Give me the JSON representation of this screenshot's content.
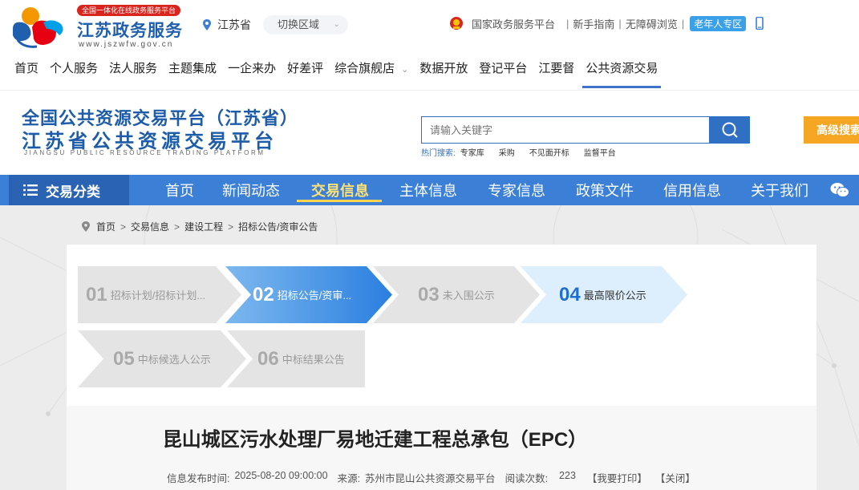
{
  "site": {
    "badge": "全国一体化在线政务服务平台",
    "name": "江苏政务服务",
    "url": "www.jszwfw.gov.cn"
  },
  "region": {
    "current": "江苏省",
    "switch_label": "切换区域"
  },
  "toplinks": {
    "national": "国家政务服务平台",
    "guide": "新手指南",
    "accessible": "无障碍浏览",
    "elder": "老年人专区"
  },
  "mainnav": [
    "首页",
    "个人服务",
    "法人服务",
    "主题集成",
    "一企来办",
    "好差评",
    "综合旗舰店",
    "数据开放",
    "登记平台",
    "江要督",
    "公共资源交易"
  ],
  "platform": {
    "title1": "全国公共资源交易平台（江苏省）",
    "title2": "江苏省公共资源交易平台",
    "title_en": "JIANGSU PUBLIC RESOURCE TRADING PLATFORM"
  },
  "search": {
    "placeholder": "请输入关键字",
    "hot_label": "热门搜索:",
    "hot_keywords": [
      "专家库",
      "采购",
      "不见面开标",
      "监督平台"
    ],
    "advanced_label": "高级搜索"
  },
  "bluenav": {
    "category_label": "交易分类",
    "items": [
      "首页",
      "新闻动态",
      "交易信息",
      "主体信息",
      "专家信息",
      "政策文件",
      "信用信息",
      "关于我们"
    ]
  },
  "breadcrumb": [
    "首页",
    "交易信息",
    "建设工程",
    "招标公告/资审公告"
  ],
  "steps": [
    {
      "num": "01",
      "label": "招标计划/招标计划...",
      "state": "inactive"
    },
    {
      "num": "02",
      "label": "招标公告/资审...",
      "state": "current"
    },
    {
      "num": "03",
      "label": "未入围公示",
      "state": "inactive"
    },
    {
      "num": "04",
      "label": "最高限价公示",
      "state": "available"
    },
    {
      "num": "05",
      "label": "中标候选人公示",
      "state": "inactive"
    },
    {
      "num": "06",
      "label": "中标结果公告",
      "state": "inactive"
    }
  ],
  "article": {
    "title": "昆山城区污水处理厂易地迁建工程总承包（EPC）",
    "publish_label": "信息发布时间:",
    "publish_time": "2025-08-20 09:00:00",
    "source_label": "来源:",
    "source": "苏州市昆山公共资源交易平台",
    "views_label": "阅读次数:",
    "views": "223",
    "print_label": "【我要打印】",
    "close_label": "【关闭】"
  },
  "colors": {
    "brand_blue": "#3b7fd6",
    "dark_blue": "#2a62b4",
    "accent_orange": "#f5a623",
    "active_nav_yellow": "#ffe074"
  }
}
